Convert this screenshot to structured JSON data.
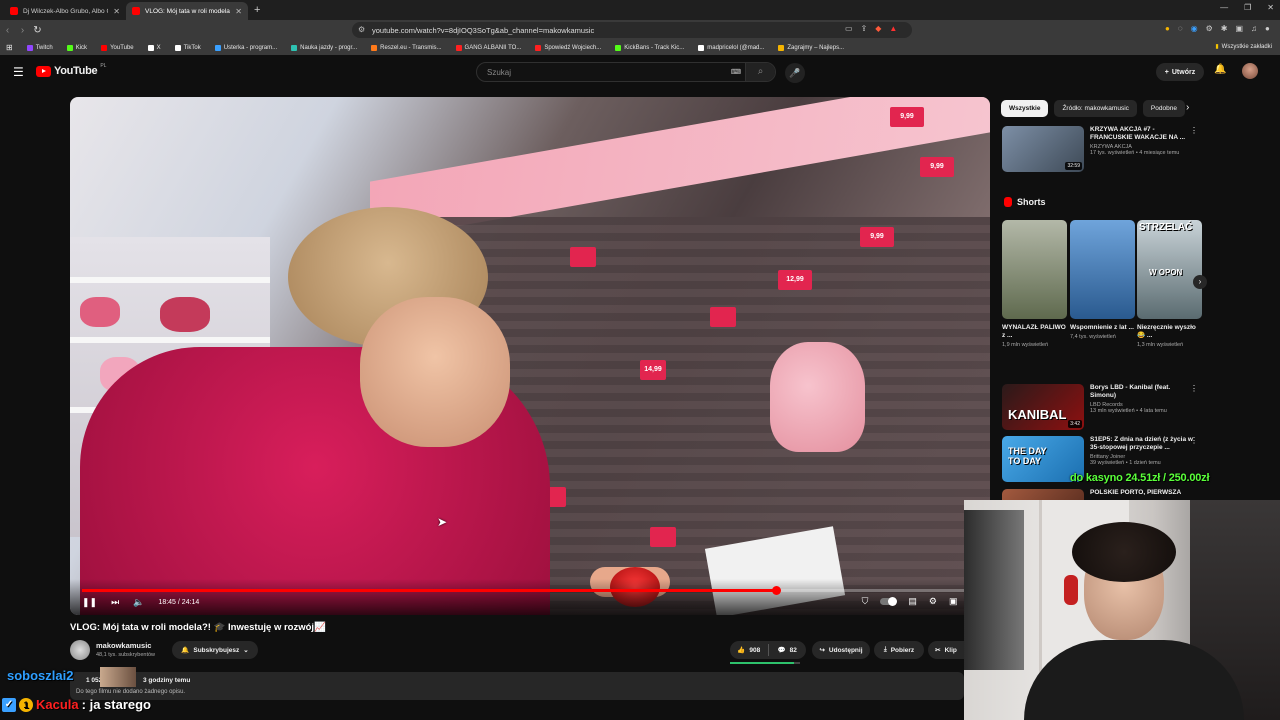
{
  "browser": {
    "tabs": [
      {
        "title": "Dj Wilczek-Albo Grubo, Albo Grubiej",
        "active": false
      },
      {
        "title": "VLOG: Mój tata w roli modela?! 🎓 Inwestuję w rozwój",
        "active": true
      }
    ],
    "url": "youtube.com/watch?v=8djIOQ3SoTg&ab_channel=makowkamusic",
    "bookmarks": [
      {
        "label": "Twitch",
        "color": "#9146ff"
      },
      {
        "label": "Kick",
        "color": "#53fc18"
      },
      {
        "label": "YouTube",
        "color": "#ff0000"
      },
      {
        "label": "X",
        "color": "#ffffff"
      },
      {
        "label": "TikTok",
        "color": "#ffffff"
      },
      {
        "label": "Usterka - program...",
        "color": "#3aa0ff"
      },
      {
        "label": "Nauka jazdy - progr...",
        "color": "#2ec2b2"
      },
      {
        "label": "Reszel.eu - Transmis...",
        "color": "#ff7a1a"
      },
      {
        "label": "GANG ALBANII TO...",
        "color": "#ff2020"
      },
      {
        "label": "Spowiedź Wojciech...",
        "color": "#ff2020"
      },
      {
        "label": "KickBans - Track Kic...",
        "color": "#53fc18"
      },
      {
        "label": "madpricelol (@mad...",
        "color": "#ffffff"
      },
      {
        "label": "Zagrajmy – Najleps...",
        "color": "#f5b400"
      }
    ],
    "all_bookmarks": "Wszystkie zakładki"
  },
  "youtube": {
    "logo": "YouTube",
    "logo_region": "PL",
    "search_placeholder": "Szukaj",
    "create_label": "Utwórz"
  },
  "video": {
    "current_time": "18:45",
    "duration": "24:14",
    "progress": 0.774,
    "title": "VLOG: Mój tata w roli modela?! 🎓 Inwestuję w rozwój📈",
    "price_tags": [
      "9,99",
      "12,99",
      "9,99",
      "14,99",
      "9,99"
    ]
  },
  "channel": {
    "name": "makowkamusic",
    "subscribers": "48,1 tys. subskrybentów",
    "subscribe_label": "Subskrybujesz"
  },
  "actions": {
    "likes": "908",
    "comments": "82",
    "share": "Udostępnij",
    "download": "Pobierz",
    "clip": "Klip",
    "like_ratio": 0.92
  },
  "description": {
    "meta": "3 godziny temu",
    "views_prefix": "1 052",
    "text": "Do tego filmu nie dodano żadnego opisu."
  },
  "filters": {
    "chips": [
      "Wszystkie",
      "Źródło: makowkamusic",
      "Podobne"
    ]
  },
  "recommendations": [
    {
      "title": "KRZYWA AKCJA #7 - FRANCUSKIE WAKACJE NA ...",
      "channel": "KRZYWA AKCJA",
      "meta": "17 tys. wyświetleń • 4 miesiące temu",
      "duration": "32:59",
      "color": "#6a7b8f"
    },
    {
      "title": "Borys LBD - Kanibal (feat. Simonu)",
      "channel": "LBD Records",
      "meta": "13 mln wyświetleń • 4 lata temu",
      "duration": "3:42",
      "color": "#b11616"
    },
    {
      "title": "S1EP5: Z dnia na dzień (z życia w 35-stopowej przyczepie ...",
      "channel": "Brittany Joiner",
      "meta": "39 wyświetleń • 1 dzień temu",
      "duration": "",
      "color": "#2b8fd4"
    },
    {
      "title": "POLSKIE PORTO, PIERWSZA",
      "channel": "",
      "meta": "",
      "duration": "",
      "color": "#7a3b2b"
    }
  ],
  "shorts": {
    "header": "Shorts",
    "items": [
      {
        "title": "WYNALAZŁ PALIWO z ...",
        "views": "1,9 mln wyświetleń",
        "color": "#7f8a6a"
      },
      {
        "title": "Wspomnienie z lat ...",
        "views": "7,4 tys. wyświetleń",
        "color": "#4d7fb8"
      },
      {
        "title": "Niezręcznie wyszło 😂 ...",
        "views": "1,3 mln wyświetleń",
        "color": "#8ea0a8"
      }
    ],
    "overlay_1": "STRZELAĆ",
    "overlay_2": "W OPON"
  },
  "rec_overlay": {
    "kanibal": "KANIBAL",
    "day_to_day": "THE DAY TO DAY"
  },
  "overlays": {
    "casino": "do kasyno 24.51zł / 250.00zł",
    "chat_user_1": "soboszlai2",
    "chat_user_2": "Kacula",
    "chat_msg_2": ": ja starego"
  }
}
